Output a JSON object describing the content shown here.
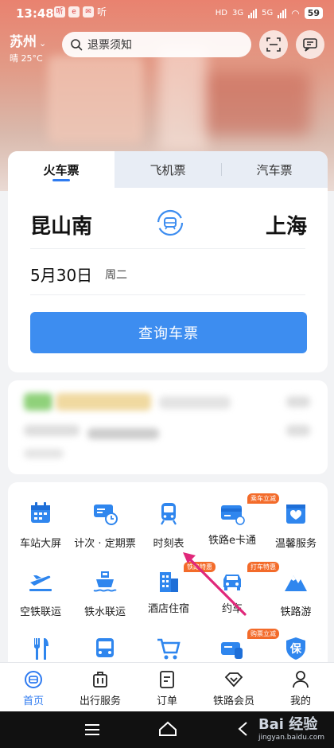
{
  "status_bar": {
    "time": "13:48",
    "app_badge_text": "听",
    "network": "HD",
    "sig1": "3G",
    "sig2": "5G",
    "battery": "59"
  },
  "location": {
    "city": "苏州",
    "weather": "晴 25°C"
  },
  "search": {
    "placeholder": "退票须知"
  },
  "ticket": {
    "tabs": [
      {
        "label": "火车票",
        "active": true
      },
      {
        "label": "飞机票",
        "active": false
      },
      {
        "label": "汽车票",
        "active": false
      }
    ],
    "from": "昆山南",
    "to": "上海",
    "date": "5月30日",
    "weekday": "周二",
    "query_label": "查询车票"
  },
  "services": [
    {
      "label": "车站大屏",
      "icon": "calendar-icon"
    },
    {
      "label": "计次 · 定期票",
      "icon": "ticket-clock-icon"
    },
    {
      "label": "时刻表",
      "icon": "train-icon"
    },
    {
      "label": "铁路e卡通",
      "icon": "card-icon",
      "tag": "乘车立减"
    },
    {
      "label": "温馨服务",
      "icon": "heart-box-icon"
    },
    {
      "label": "空铁联运",
      "icon": "plane-icon"
    },
    {
      "label": "铁水联运",
      "icon": "ship-icon"
    },
    {
      "label": "酒店住宿",
      "icon": "building-icon",
      "tag": "铁路特惠"
    },
    {
      "label": "约车",
      "icon": "car-icon",
      "tag": "打车特惠"
    },
    {
      "label": "铁路游",
      "icon": "mountain-icon"
    },
    {
      "label": "",
      "icon": "fork-knife-icon"
    },
    {
      "label": "",
      "icon": "bus-icon"
    },
    {
      "label": "",
      "icon": "cart-icon"
    },
    {
      "label": "",
      "icon": "card-train-icon",
      "tag": "购票立减"
    },
    {
      "label": "",
      "icon": "shield-icon",
      "badge": "保"
    }
  ],
  "nav": [
    {
      "label": "首页",
      "active": true,
      "icon": "home-icon"
    },
    {
      "label": "出行服务",
      "active": false,
      "icon": "luggage-icon"
    },
    {
      "label": "订单",
      "active": false,
      "icon": "order-icon"
    },
    {
      "label": "铁路会员",
      "active": false,
      "icon": "diamond-icon"
    },
    {
      "label": "我的",
      "active": false,
      "icon": "user-icon"
    }
  ],
  "watermark": {
    "brand": "Bai 经验",
    "url": "jingyan.baidu.com"
  },
  "colors": {
    "accent": "#3d8df0",
    "tag": "#f36b2a",
    "annotation": "#e0287a"
  }
}
